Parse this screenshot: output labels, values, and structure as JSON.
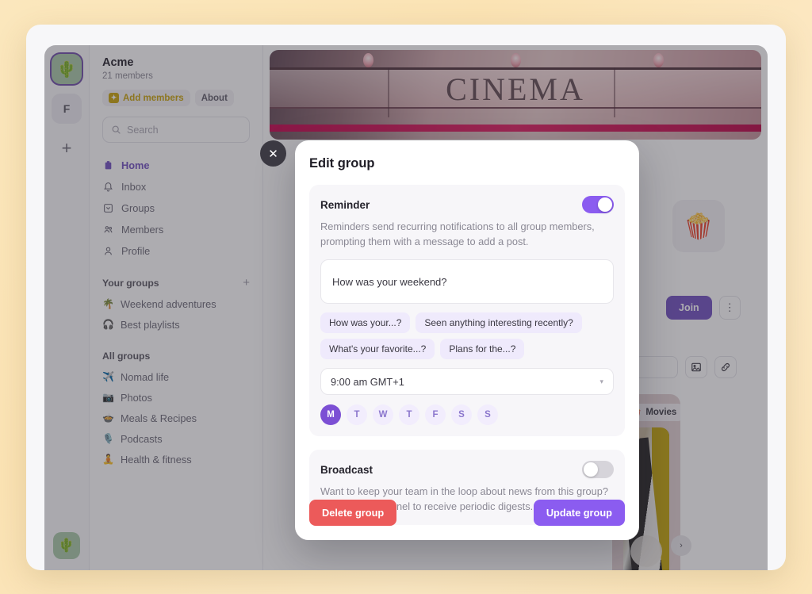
{
  "rail": {
    "workspace_active_icon": "cactus-emoji",
    "workspace_active_glyph": "🌵",
    "workspace_letter": "F",
    "add_workspace": "+",
    "bottom_glyph": "🌵"
  },
  "sidebar": {
    "org_name": "Acme",
    "member_count": "21 members",
    "add_members_label": "Add members",
    "add_members_icon_glyph": "✦",
    "about_label": "About",
    "search_placeholder": "Search",
    "search_icon": "search-icon",
    "nav": [
      {
        "label": "Home",
        "icon": "home-icon",
        "glyph": "⌂",
        "active": true
      },
      {
        "label": "Inbox",
        "icon": "bell-icon",
        "glyph": "🔔",
        "active": false
      },
      {
        "label": "Groups",
        "icon": "groups-icon",
        "glyph": "▤",
        "active": false
      },
      {
        "label": "Members",
        "icon": "members-icon",
        "glyph": "👥",
        "active": false
      },
      {
        "label": "Profile",
        "icon": "profile-icon",
        "glyph": "👤",
        "active": false
      }
    ],
    "your_groups_title": "Your groups",
    "your_groups_add": "+",
    "your_groups": [
      {
        "label": "Weekend adventures",
        "glyph": "🌴"
      },
      {
        "label": "Best playlists",
        "glyph": "🎧"
      }
    ],
    "all_groups_title": "All groups",
    "all_groups": [
      {
        "label": "Nomad life",
        "glyph": "✈️"
      },
      {
        "label": "Photos",
        "glyph": "📷"
      },
      {
        "label": "Meals & Recipes",
        "glyph": "🍲"
      },
      {
        "label": "Podcasts",
        "glyph": "🎙️"
      },
      {
        "label": "Health & fitness",
        "glyph": "🧘"
      }
    ]
  },
  "main": {
    "banner_text": "CINEMA",
    "group_avatar_glyph": "🍿",
    "join_label": "Join",
    "kebab_glyph": "⋮",
    "image_icon_glyph": "🖼",
    "link_icon_glyph": "🔗",
    "post_tag_label": "Movies",
    "post_tag_glyph": "🍿",
    "post_more_glyph": "•••",
    "scroll_glyph": "›"
  },
  "modal": {
    "title": "Edit group",
    "close_glyph": "✕",
    "reminder": {
      "title": "Reminder",
      "enabled": true,
      "description": "Reminders send recurring notifications to all group members, prompting them with a message to add a post.",
      "message_value": "How was your weekend?",
      "suggestions": [
        "How was your...?",
        "Seen anything interesting recently?",
        "What's your favorite...?",
        "Plans for the...?"
      ],
      "time_value": "9:00 am GMT+1",
      "caret_glyph": "▾",
      "days": [
        {
          "label": "M",
          "selected": true
        },
        {
          "label": "T",
          "selected": false
        },
        {
          "label": "W",
          "selected": false
        },
        {
          "label": "T",
          "selected": false
        },
        {
          "label": "F",
          "selected": false
        },
        {
          "label": "S",
          "selected": false
        },
        {
          "label": "S",
          "selected": false
        }
      ]
    },
    "broadcast": {
      "title": "Broadcast",
      "enabled": false,
      "description": "Want to keep your team in the loop about news from this group? Set a Slack channel to receive periodic digests."
    },
    "delete_label": "Delete group",
    "update_label": "Update group"
  },
  "colors": {
    "accent_purple": "#8b5cf0",
    "selected_day": "#7c4fd4",
    "danger_red": "#ec5a5a",
    "brand_gold": "#c8a206",
    "join_purple": "#6f4fc0",
    "page_background": "#fbe7bd"
  }
}
